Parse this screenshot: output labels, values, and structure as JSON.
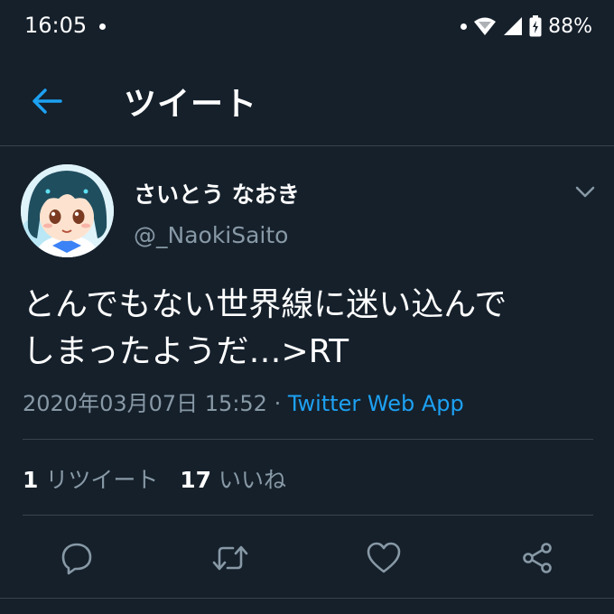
{
  "status_bar": {
    "time": "16:05",
    "battery": "88%"
  },
  "header": {
    "title": "ツイート"
  },
  "tweet": {
    "display_name": "さいとう なおき",
    "username": "@_NaokiSaito",
    "text_line1": "とんでもない世界線に迷い込んで",
    "text_line2": "しまったようだ…>RT",
    "timestamp": "2020年03月07日 15:52",
    "separator": " · ",
    "source": "Twitter Web App"
  },
  "stats": {
    "retweets_count": "1",
    "retweets_label": "リツイート",
    "likes_count": "17",
    "likes_label": "いいね"
  },
  "colors": {
    "background": "#15202b",
    "accent": "#1da1f2",
    "secondary_text": "#8899a6",
    "divider": "#38444d"
  },
  "icons": {
    "back": "arrow-left-icon",
    "more": "chevron-down-icon",
    "reply": "reply-icon",
    "retweet": "retweet-icon",
    "like": "heart-icon",
    "share": "share-icon"
  }
}
